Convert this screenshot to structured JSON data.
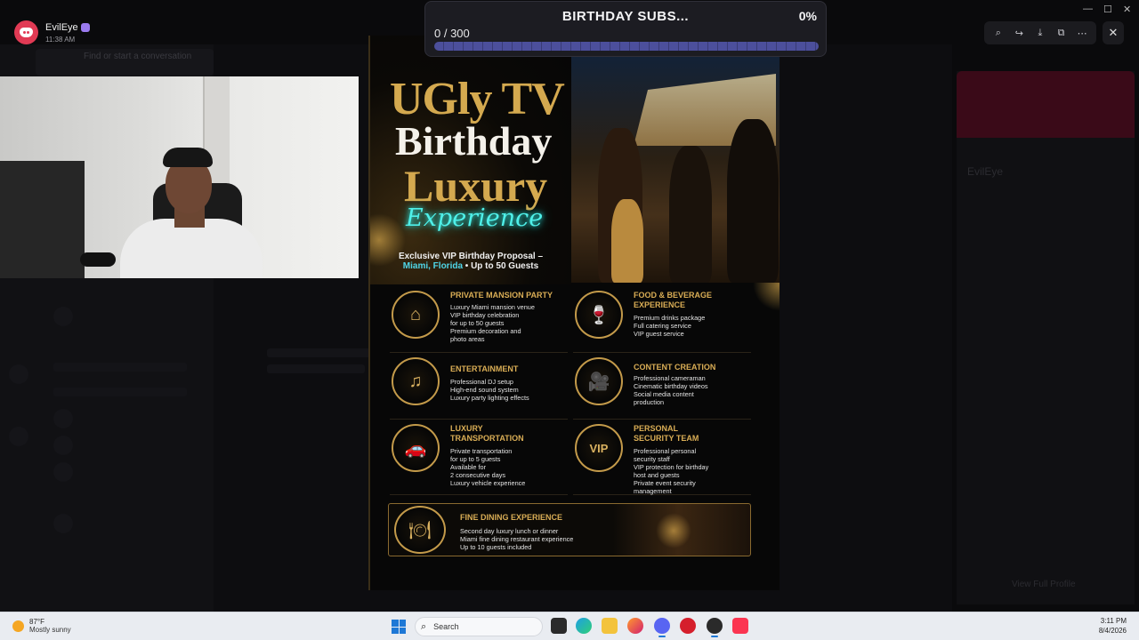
{
  "window": {
    "username": "EvilEye",
    "time": "11:38 AM",
    "controls": [
      "—",
      "☐",
      "✕"
    ],
    "toolbar_icons": [
      "zoom-icon",
      "share-icon",
      "download-icon",
      "open-external-icon",
      "more-icon"
    ],
    "close_glyph": "✕"
  },
  "background": {
    "dm_search": "Find or start a conversation",
    "profile_name": "EvilEye",
    "view_full_profile": "View Full Profile"
  },
  "goal": {
    "title": "BIRTHDAY SUBS...",
    "percent_label": "0%",
    "count_label": "0 / 300",
    "progress": 0.0,
    "track_color": "#4c4f9c",
    "fill_color": "#8c90ff"
  },
  "flyer": {
    "title_line1": "UGly TV",
    "title_line2": "Birthday",
    "title_line3": "Luxury",
    "title_line4": "Experience",
    "subtitle_line1": "Exclusive VIP Birthday Proposal –",
    "subtitle_location": "Miami, Florida",
    "subtitle_rest": " • Up to 50 Guests",
    "services": [
      {
        "title": "PRIVATE MANSION PARTY",
        "icon": "mansion-icon",
        "glyph": "⌂",
        "lines": [
          "Luxury Miami mansion venue",
          "VIP birthday celebration",
          "for up to 50 guests",
          "Premium decoration and",
          "photo areas"
        ]
      },
      {
        "title": "FOOD & BEVERAGE EXPERIENCE",
        "icon": "champagne-icon",
        "glyph": "🍷",
        "lines": [
          "Premium drinks package",
          "Full catering service",
          "VIP guest service"
        ]
      },
      {
        "title": "ENTERTAINMENT",
        "icon": "speaker-icon",
        "glyph": "♫",
        "lines": [
          "Professional DJ setup",
          "High-end sound system",
          "Luxury party lighting effects"
        ]
      },
      {
        "title": "CONTENT CREATION",
        "icon": "camera-icon",
        "glyph": "🎥",
        "lines": [
          "Professional cameraman",
          "Cinematic birthday videos",
          "Social media content",
          "production"
        ]
      },
      {
        "title": "LUXURY TRANSPORTATION",
        "icon": "car-icon",
        "glyph": "🚗",
        "lines": [
          "Private transportation",
          "for up to 5 guests",
          "Available for",
          "2 consecutive days",
          "Luxury vehicle experience"
        ]
      },
      {
        "title": "PERSONAL SECURITY TEAM",
        "icon": "vip-shield-icon",
        "glyph": "VIP",
        "lines": [
          "Professional personal",
          "security staff",
          "VIP protection for birthday",
          "host and guests",
          "Private event security",
          "management"
        ]
      }
    ],
    "dining": {
      "title": "FINE DINING EXPERIENCE",
      "icon": "cloche-icon",
      "glyph": "🍽",
      "lines": [
        "Second day luxury lunch or dinner",
        "Miami fine dining restaurant experience",
        "Up to 10 guests included"
      ]
    },
    "gold_color": "#d4a94f",
    "neon_color": "#4ff0e9"
  },
  "taskbar": {
    "weather_temp": "87°F",
    "weather_condition": "Mostly sunny",
    "search_label": "Search",
    "apps": [
      "task-view-icon",
      "edge-icon",
      "file-explorer-icon",
      "firefox-icon",
      "discord-icon",
      "media-player-icon",
      "obs-icon",
      "apple-music-icon"
    ],
    "clock_time": "3:11 PM",
    "clock_date": "8/4/2026"
  }
}
